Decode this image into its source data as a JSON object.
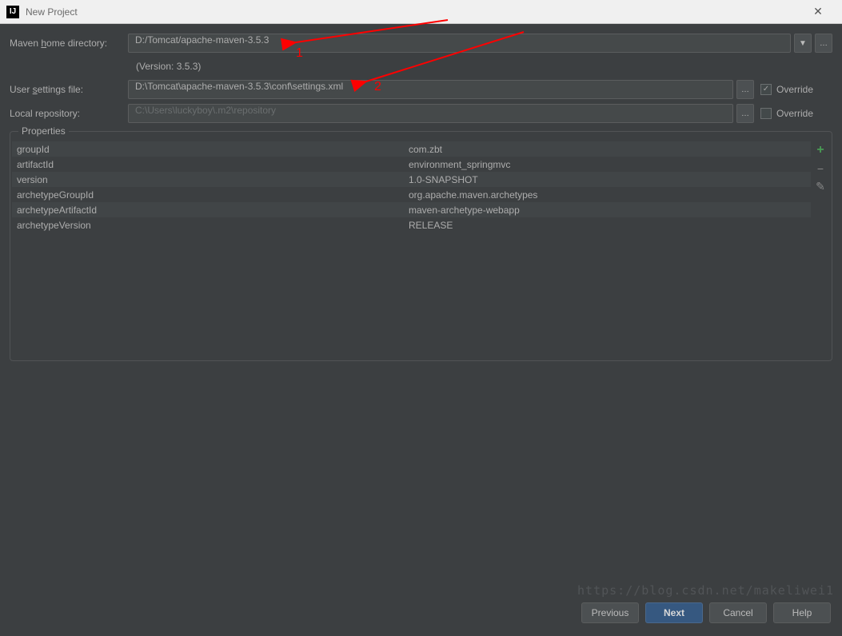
{
  "titlebar": {
    "title": "New Project",
    "icon_text": "IJ"
  },
  "fields": {
    "maven_home": {
      "label_pre": "Maven ",
      "label_u": "h",
      "label_post": "ome directory:",
      "value": "D:/Tomcat/apache-maven-3.5.3"
    },
    "version": "(Version: 3.5.3)",
    "settings": {
      "label_pre": "User ",
      "label_u": "s",
      "label_post": "ettings file:",
      "value": "D:\\Tomcat\\apache-maven-3.5.3\\conf\\settings.xml",
      "override_label": "Override",
      "override_checked": true
    },
    "local_repo": {
      "label": "Local repository:",
      "value": "C:\\Users\\luckyboy\\.m2\\repository",
      "override_label": "Override",
      "override_checked": false
    }
  },
  "properties": {
    "legend": "Properties",
    "rows": [
      {
        "key": "groupId",
        "val": "com.zbt"
      },
      {
        "key": "artifactId",
        "val": "environment_springmvc"
      },
      {
        "key": "version",
        "val": "1.0-SNAPSHOT"
      },
      {
        "key": "archetypeGroupId",
        "val": "org.apache.maven.archetypes"
      },
      {
        "key": "archetypeArtifactId",
        "val": "maven-archetype-webapp"
      },
      {
        "key": "archetypeVersion",
        "val": "RELEASE"
      }
    ]
  },
  "buttons": {
    "previous": "Previous",
    "next": "Next",
    "cancel": "Cancel",
    "help": "Help"
  },
  "annotations": {
    "num1": "1",
    "num2": "2"
  },
  "watermark": "https://blog.csdn.net/makeliwei1"
}
